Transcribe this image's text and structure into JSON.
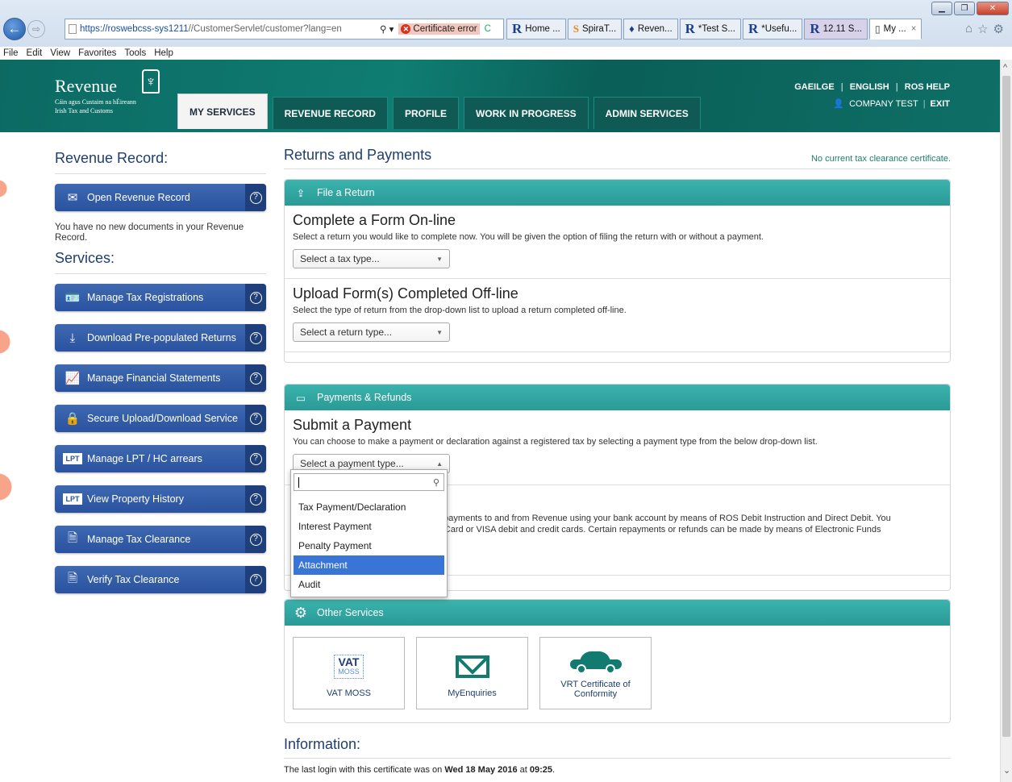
{
  "browser": {
    "address_url_main": "https://roswebcss-sys1211",
    "address_url_rest": "//CustomerServlet/customer?lang=en",
    "search_symbol": "⚲ ▾",
    "cert_error": "Certificate error",
    "refresh_symbol": "C",
    "tabs": [
      {
        "icon": "R",
        "label": "Home ..."
      },
      {
        "icon": "S",
        "label": "SpiraT..."
      },
      {
        "icon": "♦",
        "label": "Reven..."
      },
      {
        "icon": "R",
        "label": "*Test S..."
      },
      {
        "icon": "R",
        "label": "*Usefu..."
      },
      {
        "icon": "R",
        "label": "12.11 S..."
      },
      {
        "icon": "▯",
        "label": "My ...",
        "close": "×"
      }
    ],
    "menu": [
      "File",
      "Edit",
      "View",
      "Favorites",
      "Tools",
      "Help"
    ]
  },
  "header": {
    "logo_name": "Revenue",
    "logo_sub1": "Cáin agus Custaim na hÉireann",
    "logo_sub2": "Irish Tax and Customs",
    "links": [
      "GAEILGE",
      "ENGLISH",
      "ROS HELP"
    ],
    "user": "COMPANY TEST",
    "exit": "EXIT",
    "nav": [
      "MY SERVICES",
      "REVENUE RECORD",
      "PROFILE",
      "WORK IN PROGRESS",
      "ADMIN SERVICES"
    ]
  },
  "left": {
    "record_heading": "Revenue Record:",
    "open_record": "Open Revenue Record",
    "no_docs": "You have no new documents in your Revenue Record.",
    "services_heading": "Services:",
    "services": [
      "Manage Tax Registrations",
      "Download Pre-populated Returns",
      "Manage Financial Statements",
      "Secure Upload/Download Service",
      "Manage LPT / HC arrears",
      "View Property History",
      "Manage Tax Clearance",
      "Verify Tax Clearance"
    ]
  },
  "main": {
    "heading": "Returns and Payments",
    "clearance": "No current tax clearance certificate.",
    "file_return_title": "File a Return",
    "complete_heading": "Complete a Form On-line",
    "complete_text": "Select a return you would like to complete now. You will be given the option of filing the return with or without a payment.",
    "tax_type_placeholder": "Select a tax type...",
    "upload_heading": "Upload Form(s) Completed Off-line",
    "upload_text": "Select the type of return from the drop-down list to upload a return completed off-line.",
    "return_type_placeholder": "Select a return type...",
    "payments_title": "Payments & Refunds",
    "submit_heading": "Submit a Payment",
    "submit_text": "You can choose to make a payment or declaration against a registered tax by selecting a payment type from the below drop-down list.",
    "payment_type_placeholder": "Select a payment type...",
    "payment_options": [
      "Tax Payment/Declaration",
      "Interest Payment",
      "Penalty Payment",
      "Attachment",
      "Audit"
    ],
    "hidden_text_1": "e payments to and from Revenue using your bank account by means of ROS Debit Instruction and Direct Debit. You",
    "hidden_text_2": "erCard or VISA debit and credit cards. Certain repayments or refunds can be made by means of Electronic Funds",
    "other_title": "Other Services",
    "vat_badge": "VAT",
    "vat_badge_sub": "MOSS",
    "other_services": [
      "VAT MOSS",
      "MyEnquiries",
      "VRT Certificate of Conformity"
    ],
    "info_heading": "Information:",
    "last_login_prefix": "The last login with this certificate was on ",
    "last_login_date": "Wed 18 May 2016",
    "last_login_mid": " at ",
    "last_login_time": "09:25",
    "last_login_suffix": "."
  },
  "colors": {
    "teal": "#2a9a96",
    "banner": "#0f7d72",
    "button_blue": "#2a52a0",
    "highlight": "#3875d7"
  }
}
